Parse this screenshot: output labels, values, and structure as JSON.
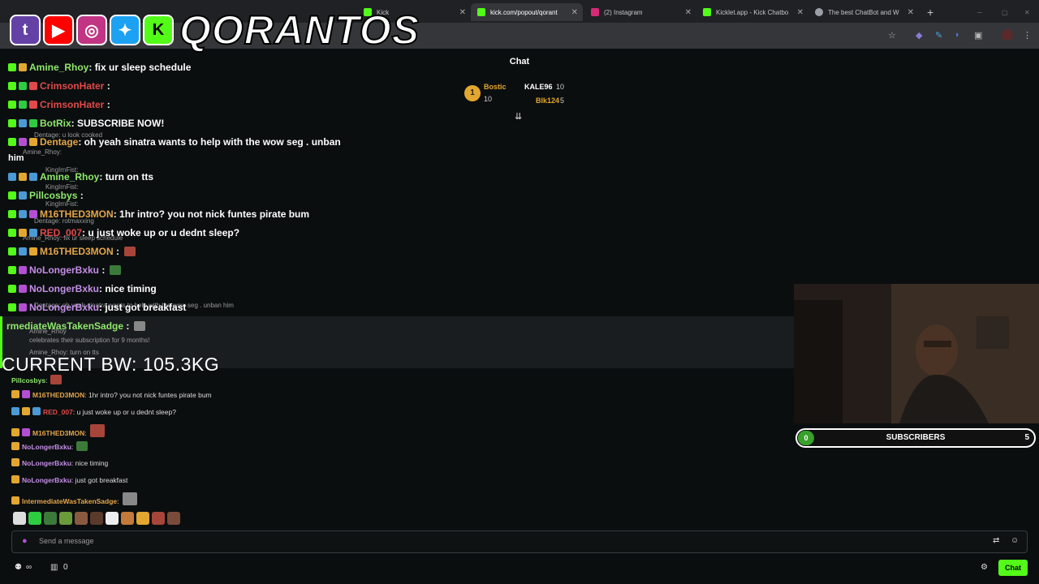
{
  "browser": {
    "tabs": [
      {
        "label": "Kick",
        "color": "#53fc18"
      },
      {
        "label": "kick.com/popout/qorant",
        "color": "#53fc18"
      },
      {
        "label": "(2) Instagram",
        "color": "#d62976"
      },
      {
        "label": "Kicklet.app - Kick Chatbo",
        "color": "#53fc18"
      },
      {
        "label": "The best ChatBot and W",
        "color": "#9aa0a6"
      }
    ]
  },
  "overlay": {
    "name": "QORANTOS"
  },
  "chat": {
    "title": "Chat",
    "leaderboard": {
      "first_rank": "1",
      "first_name": "Bostic",
      "first_count": "10",
      "second_name": "KALE96",
      "second_count": "10",
      "third_name": "Blk124",
      "third_count": "5"
    },
    "big_messages": [
      {
        "user": "Amine_Rhoy",
        "text": ": fix ur sleep schedule",
        "color": "#8ee86c"
      },
      {
        "user": "CrimsonHater",
        "text": " :",
        "color": "#e04a4a"
      },
      {
        "user": "CrimsonHater",
        "text": " :",
        "color": "#e04a4a"
      },
      {
        "user": "BotRix",
        "text": ": SUBSCRIBE NOW!",
        "color": "#8ee86c"
      },
      {
        "user": "Dentage",
        "text": ": oh yeah sinatra wants to help with the wow seg . unban",
        "color": "#e3a64a"
      },
      {
        "user": "Amine_Rhoy",
        "text": ": turn on tts",
        "color": "#8ee86c"
      },
      {
        "user": "Pillcosbys",
        "text": " :",
        "color": "#8ee86c"
      },
      {
        "user": "M16THED3MON",
        "text": ": 1hr intro? you not nick funtes pirate bum",
        "color": "#e3a64a"
      },
      {
        "user": "RED_007",
        "text": ": u just woke up or u dednt sleep?",
        "color": "#e04a4a"
      },
      {
        "user": "M16THED3MON",
        "text": " :",
        "color": "#e3a64a"
      },
      {
        "user": "NoLongerBxku",
        "text": " :",
        "color": "#c58ee8"
      },
      {
        "user": "NoLongerBxku",
        "text": ": nice timing",
        "color": "#c58ee8"
      },
      {
        "user": "NoLongerBxku",
        "text": ": just got breakfast",
        "color": "#c58ee8"
      },
      {
        "user": "rmediateWasTakenSadge",
        "text": " :",
        "color": "#8ee86c"
      }
    ],
    "wrap_word": "him",
    "ghosts": [
      "Dentage: u look cooked",
      "Amine_Rhoy:",
      "KingIrnFist:",
      "KingIrnFist:",
      "KingIrnFist:",
      "Dentage: rotmaxxing",
      "Amine_Rhoy: fix ur sleep schedule",
      "Dentage: oh yeah sinatra wants to help with the wow seg . unban him",
      "Amine_Rhoy",
      "celebrates their subscription for 9 months!",
      "Amine_Rhoy: turn on tts"
    ],
    "small_messages": [
      {
        "user": "Pillcosbys",
        "text": ":",
        "color": "#8ee86c"
      },
      {
        "user": "M16THED3MON",
        "text": ": 1hr intro? you not nick funtes pirate bum",
        "color": "#e3a64a"
      },
      {
        "user": "RED_007",
        "text": ": u just woke up or u dednt sleep?",
        "color": "#e04a4a"
      },
      {
        "user": "M16THED3MON",
        "text": ":",
        "color": "#e3a64a"
      },
      {
        "user": "NoLongerBxku",
        "text": ":",
        "color": "#c58ee8"
      },
      {
        "user": "NoLongerBxku",
        "text": ": nice timing",
        "color": "#c58ee8"
      },
      {
        "user": "NoLongerBxku",
        "text": ": just got breakfast",
        "color": "#c58ee8"
      },
      {
        "user": "IntermediateWasTakenSadge",
        "text": ":",
        "color": "#e3a64a"
      }
    ],
    "input_placeholder": "Send a message",
    "send_label": "Chat",
    "footer_count": "0"
  },
  "stream": {
    "bodyweight": "CURRENT BW: 105.3KG",
    "subs_current": "0",
    "subs_label": "SUBSCRIBERS",
    "subs_goal": "5"
  },
  "colors": {
    "accent": "#53fc18",
    "background": "#0b0e0f"
  }
}
